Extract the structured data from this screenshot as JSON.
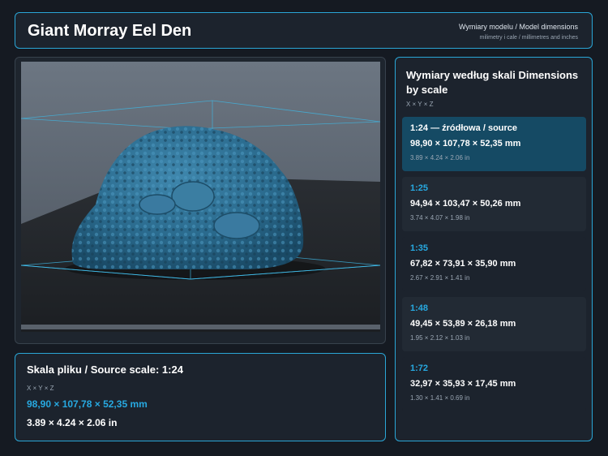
{
  "header": {
    "title": "Giant Morray Eel Den",
    "subtitle": "Wymiary modelu / Model dimensions",
    "units_note": "milimetry i cale / millimetres and inches"
  },
  "colors": {
    "accent": "#27a9e1",
    "border": "#2aa6d6",
    "background": "#151a22",
    "panel": "#1c232d",
    "selected": "#154a64",
    "model": "#2c6f93"
  },
  "source": {
    "title": "Skala pliku / Source scale: 1:24",
    "axes": "X × Y × Z",
    "mm": "98,90 × 107,78 × 52,35 mm",
    "inches": "3.89 × 4.24 × 2.06 in"
  },
  "scales": {
    "title": "Wymiary według skali Dimensions by scale",
    "axes": "X × Y × Z",
    "items": [
      {
        "label": "1:24  —  źródłowa / source",
        "mm": "98,90 × 107,78 × 52,35 mm",
        "inches": "3.89 × 4.24 × 2.06 in",
        "selected": true
      },
      {
        "label": "1:25",
        "mm": "94,94 × 103,47 × 50,26 mm",
        "inches": "3.74 × 4.07 × 1.98 in",
        "selected": false
      },
      {
        "label": "1:35",
        "mm": "67,82 × 73,91 × 35,90 mm",
        "inches": "2.67 × 2.91 × 1.41 in",
        "selected": false
      },
      {
        "label": "1:48",
        "mm": "49,45 × 53,89 × 26,18 mm",
        "inches": "1.95 × 2.12 × 1.03 in",
        "selected": false
      },
      {
        "label": "1:72",
        "mm": "32,97 × 35,93 × 17,45 mm",
        "inches": "1.30 × 1.41 × 0.69 in",
        "selected": false
      }
    ]
  }
}
